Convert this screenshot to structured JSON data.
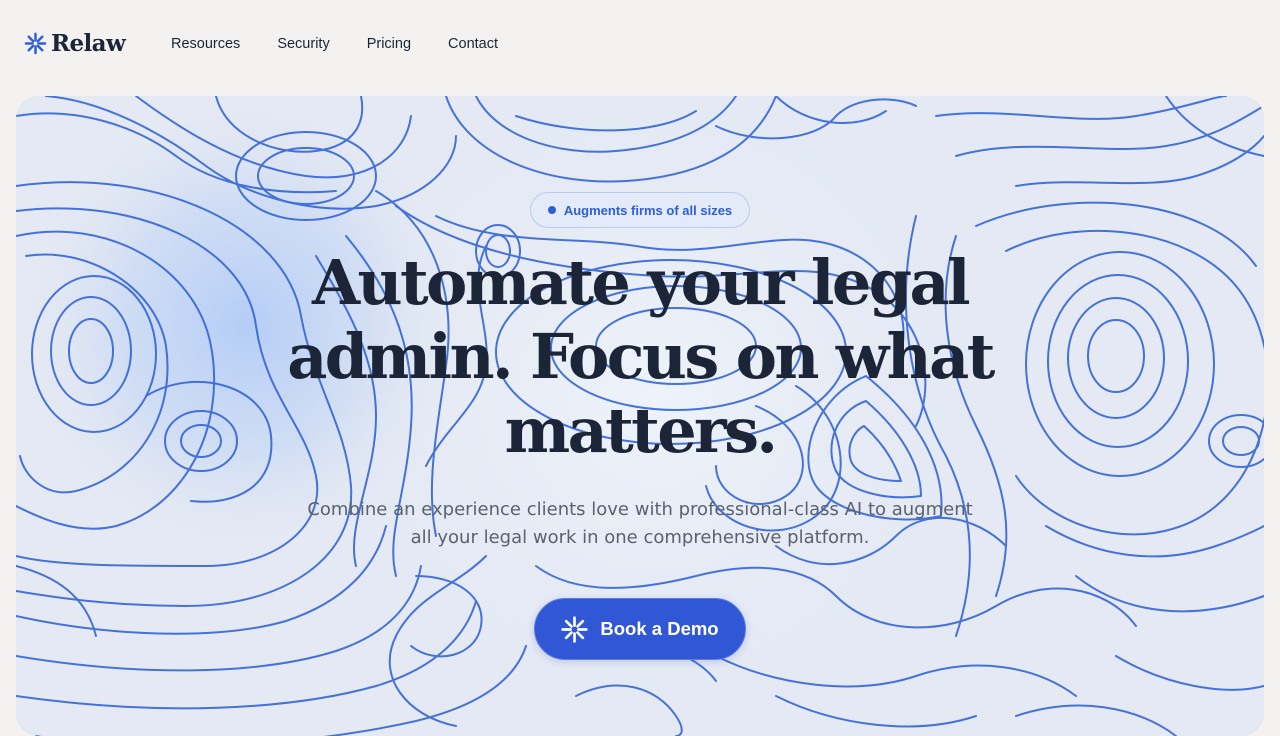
{
  "brand": {
    "name": "Relaw",
    "icon": "asterisk-icon",
    "color": "#2f5fd4"
  },
  "nav": {
    "links": [
      {
        "label": "Resources"
      },
      {
        "label": "Security"
      },
      {
        "label": "Pricing"
      },
      {
        "label": "Contact"
      }
    ]
  },
  "hero": {
    "badge": "Augments firms of all sizes",
    "headline_lines": [
      "Automate your legal",
      "admin. Focus on what",
      "matters."
    ],
    "subtext_lines": [
      "Combine an experience clients love with professional-class AI to augment",
      "all your legal work in one comprehensive platform."
    ],
    "cta": {
      "label": "Book a Demo",
      "icon": "asterisk-icon"
    },
    "background": "topographic-contour-lines",
    "colors": {
      "line": "#2f62d6",
      "panel": "#e4e9f3",
      "button": "#2f57d6"
    }
  }
}
